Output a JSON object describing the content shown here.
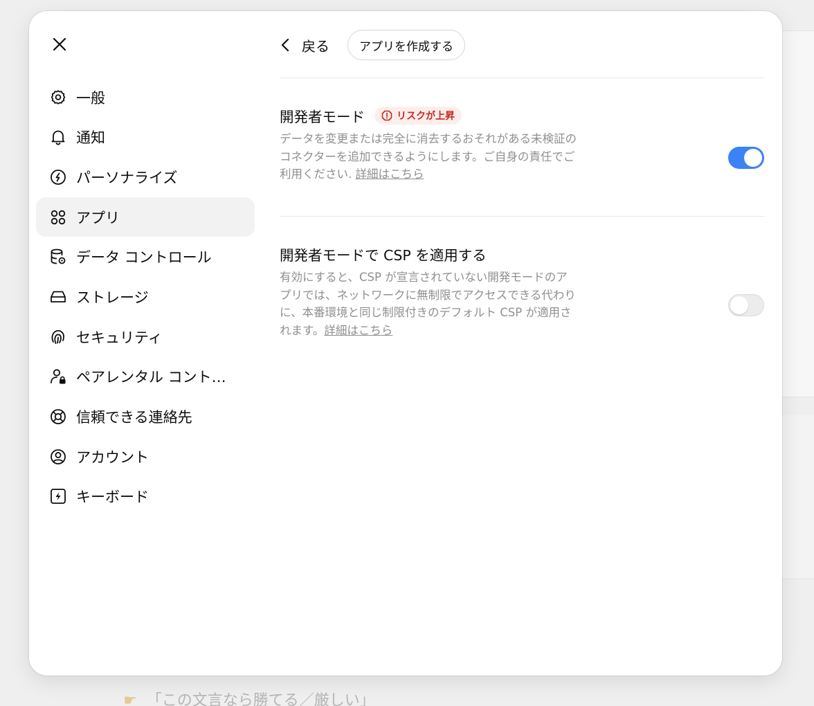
{
  "background": {
    "footer_text": "「この文言なら勝てる／厳しい」"
  },
  "nav": {
    "items": [
      {
        "label": "一般",
        "icon": "gear-icon"
      },
      {
        "label": "通知",
        "icon": "bell-icon"
      },
      {
        "label": "パーソナライズ",
        "icon": "personalize-icon"
      },
      {
        "label": "アプリ",
        "icon": "apps-grid-icon",
        "active": true
      },
      {
        "label": "データ コントロール",
        "icon": "database-gear-icon"
      },
      {
        "label": "ストレージ",
        "icon": "storage-icon"
      },
      {
        "label": "セキュリティ",
        "icon": "fingerprint-icon"
      },
      {
        "label": "ペアレンタル コント…",
        "icon": "parental-lock-icon"
      },
      {
        "label": "信頼できる連絡先",
        "icon": "lifebuoy-icon"
      },
      {
        "label": "アカウント",
        "icon": "account-icon"
      },
      {
        "label": "キーボード",
        "icon": "keyboard-bolt-icon"
      }
    ]
  },
  "header": {
    "back_label": "戻る",
    "create_app_label": "アプリを作成する"
  },
  "settings": {
    "developer_mode": {
      "title": "開発者モード",
      "badge": "リスクが上昇",
      "description": "データを変更または完全に消去するおそれがある未検証のコネクターを追加できるようにします。ご自身の責任でご利用ください.",
      "link": "詳細はこちら",
      "enabled": true
    },
    "csp": {
      "title": "開発者モードで CSP を適用する",
      "description": "有効にすると、CSP が宣言されていない開発モードのアプリでは、ネットワークに無制限でアクセスできる代わりに、本番環境と同じ制限付きのデフォルト CSP が適用されます。",
      "link": "詳細はこちら",
      "enabled": false
    }
  },
  "colors": {
    "accent": "#3b82f6",
    "risk": "#c8281e",
    "risk_bg": "#fdeeec"
  }
}
